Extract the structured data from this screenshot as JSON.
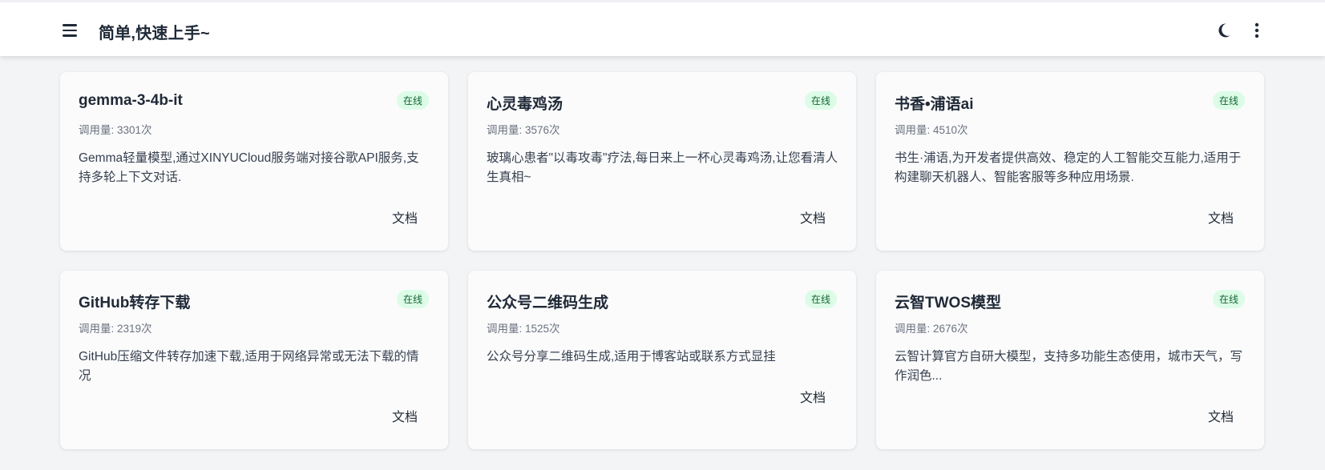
{
  "header": {
    "title": "简单,快速上手~"
  },
  "colors": {
    "badge_bg": "#dcfce7",
    "badge_text": "#166534",
    "page_bg": "#f3f4f6"
  },
  "cards": [
    {
      "title": "gemma-3-4b-it",
      "status": "在线",
      "calls": "调用量: 3301次",
      "description": "Gemma轻量模型,通过XINYUCloud服务端对接谷歌API服务,支持多轮上下文对话.",
      "doc_label": "文档"
    },
    {
      "title": "心灵毒鸡汤",
      "status": "在线",
      "calls": "调用量: 3576次",
      "description": "玻璃心患者\"以毒攻毒\"疗法,每日来上一杯心灵毒鸡汤,让您看清人生真相~",
      "doc_label": "文档"
    },
    {
      "title": "书香•浦语ai",
      "status": "在线",
      "calls": "调用量: 4510次",
      "description": "书生·浦语,为开发者提供高效、稳定的人工智能交互能力,适用于构建聊天机器人、智能客服等多种应用场景.",
      "doc_label": "文档"
    },
    {
      "title": "GitHub转存下载",
      "status": "在线",
      "calls": "调用量: 2319次",
      "description": "GitHub压缩文件转存加速下载,适用于网络异常或无法下载的情况",
      "doc_label": "文档"
    },
    {
      "title": "公众号二维码生成",
      "status": "在线",
      "calls": "调用量: 1525次",
      "description": "公众号分享二维码生成,适用于博客站或联系方式显挂",
      "doc_label": "文档"
    },
    {
      "title": "云智TWOS模型",
      "status": "在线",
      "calls": "调用量: 2676次",
      "description": "云智计算官方自研大模型，支持多功能生态使用，城市天气，写作润色...",
      "doc_label": "文档"
    }
  ]
}
